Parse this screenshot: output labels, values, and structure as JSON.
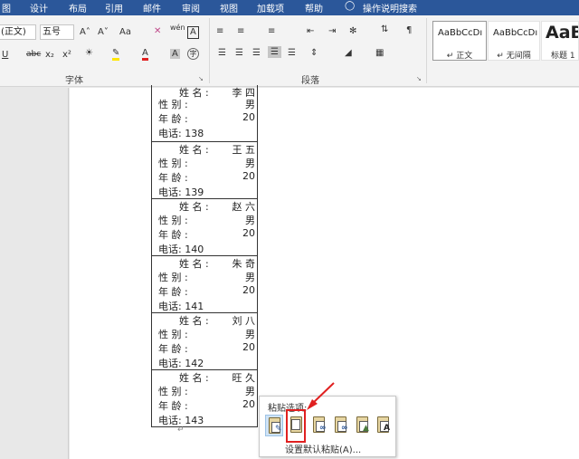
{
  "ribbon_tabs": [
    "图",
    "设计",
    "布局",
    "引用",
    "邮件",
    "审阅",
    "视图",
    "加载项",
    "帮助",
    "操作说明搜索"
  ],
  "font": {
    "name_value": "(正文)",
    "size_value": "五号",
    "group_label": "字体",
    "grow_label": "A˄",
    "shrink_label": "A˅",
    "case_label": "Aa",
    "phonetic_label": "wén",
    "border_char_label": "A",
    "underline_label": "U",
    "strike_label": "abc",
    "sub_label": "x₂",
    "sup_label": "x²",
    "font_color_label": "A",
    "shading_label": "A",
    "enclose_label": "字"
  },
  "paragraph": {
    "group_label": "段落"
  },
  "styles": [
    {
      "preview": "AaBbCcDı",
      "name": "↵ 正文"
    },
    {
      "preview": "AaBbCcDı",
      "name": "↵ 无间隔"
    },
    {
      "preview": "AaB",
      "name": "标题 1"
    }
  ],
  "records": [
    {
      "name_label": "姓 名 :",
      "name": "李 四",
      "gender_label": "性    别    :",
      "gender": "男",
      "age_label": "年    龄    :",
      "age": "20",
      "phone": "电话: 138"
    },
    {
      "name_label": "姓 名 :",
      "name": "王 五",
      "gender_label": "性    别    :",
      "gender": "男",
      "age_label": "年    龄    :",
      "age": "20",
      "phone": "电话: 139"
    },
    {
      "name_label": "姓 名 :",
      "name": "赵 六",
      "gender_label": "性    别    :",
      "gender": "男",
      "age_label": "年    龄    :",
      "age": "20",
      "phone": "电话: 140"
    },
    {
      "name_label": "姓 名 :",
      "name": "朱 奇",
      "gender_label": "性    别    :",
      "gender": "男",
      "age_label": "年    龄    :",
      "age": "20",
      "phone": "电话: 141"
    },
    {
      "name_label": "姓 名 :",
      "name": "刘 八",
      "gender_label": "性    别    :",
      "gender": "男",
      "age_label": "年    龄    :",
      "age": "20",
      "phone": "电话: 142"
    },
    {
      "name_label": "姓 名 :",
      "name": "旺 久",
      "gender_label": "性    别    :",
      "gender": "男",
      "age_label": "年    龄    :",
      "age": "20",
      "phone": "电话: 143"
    }
  ],
  "paste_popup": {
    "title": "粘贴选项:",
    "default_label": "设置默认粘贴(A)...",
    "options": [
      "keep-source-formatting",
      "keep-text-only",
      "merge-formatting",
      "use-destination-styles",
      "picture",
      "keep-text-only-a"
    ]
  },
  "colors": {
    "ribbon_tab_bg": "#2b579a",
    "highlight_red": "#e02020",
    "page_bg": "#ffffff"
  }
}
